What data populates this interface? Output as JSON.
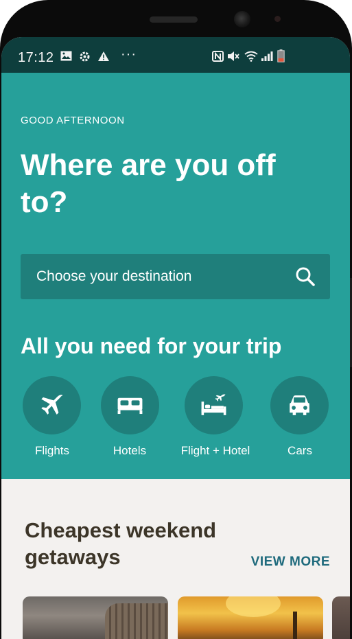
{
  "status_bar": {
    "time": "17:12",
    "left_icons": [
      "image-icon",
      "settings-icon",
      "warning-icon",
      "more-dots-icon"
    ],
    "right_icons": [
      "nfc-icon",
      "mute-icon",
      "wifi-icon",
      "signal-icon",
      "battery-icon"
    ]
  },
  "hero": {
    "greeting": "GOOD AFTERNOON",
    "headline": "Where are you off to?",
    "search": {
      "placeholder": "Choose your destination",
      "icon": "search-icon"
    },
    "section_title": "All you need for your trip",
    "categories": [
      {
        "label": "Flights",
        "icon": "airplane-icon"
      },
      {
        "label": "Hotels",
        "icon": "bed-icon"
      },
      {
        "label": "Flight + Hotel",
        "icon": "flight-hotel-icon"
      },
      {
        "label": "Cars",
        "icon": "car-icon"
      }
    ]
  },
  "getaways": {
    "title": "Cheapest weekend getaways",
    "view_more": "VIEW MORE",
    "cards": [
      "card-rome",
      "card-barcelona",
      "card-partial"
    ]
  },
  "colors": {
    "hero_bg": "#26a09a",
    "hero_dark": "#1f7f7b",
    "status_bar_bg": "#0e3e3d",
    "content_bg": "#f3f1ef",
    "title_text": "#3c3528",
    "link_text": "#1e6a7c"
  }
}
